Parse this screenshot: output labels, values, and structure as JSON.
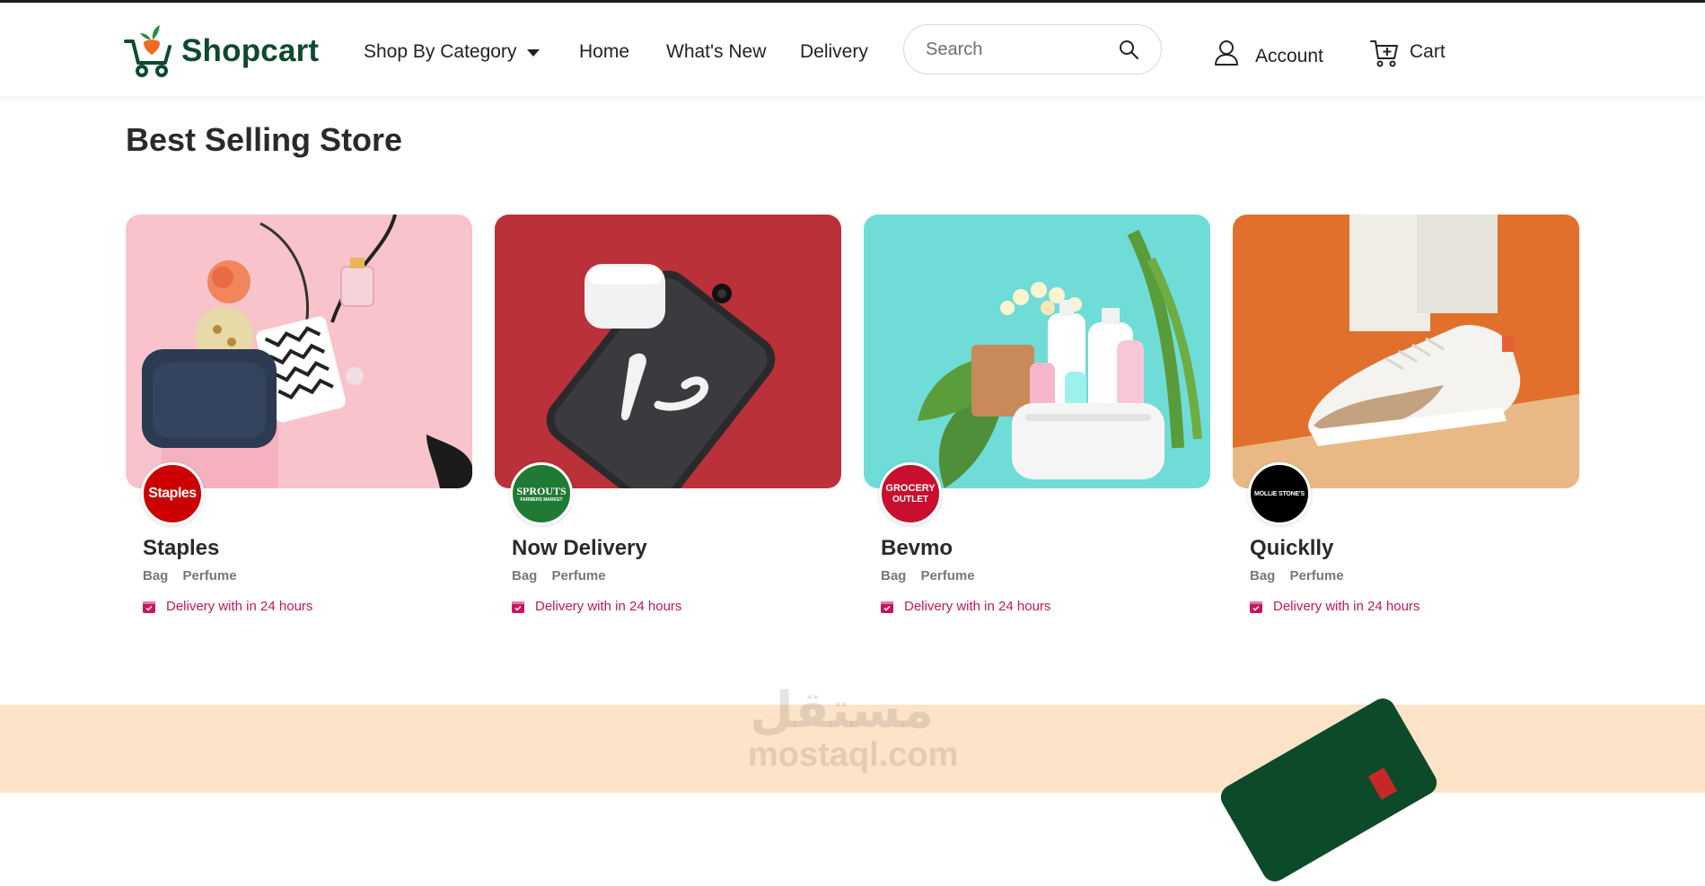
{
  "brand": {
    "name": "Shopcart"
  },
  "nav": {
    "category_label": "Shop By Category",
    "links": [
      "Home",
      "What's New",
      "Delivery"
    ],
    "search_placeholder": "Search",
    "account_label": "Account",
    "cart_label": "Cart"
  },
  "section": {
    "title": "Best Selling Store"
  },
  "stores": [
    {
      "name": "Staples",
      "tags": [
        "Bag",
        "Perfume"
      ],
      "delivery": "Delivery with in 24 hours",
      "logo_text": "Staples",
      "logo_bg": "#cc0000"
    },
    {
      "name": "Now Delivery",
      "tags": [
        "Bag",
        "Perfume"
      ],
      "delivery": "Delivery with in 24 hours",
      "logo_text": "SPROUTS",
      "logo_subtext": "FARMERS MARKET",
      "logo_bg": "#1f7a34"
    },
    {
      "name": "Bevmo",
      "tags": [
        "Bag",
        "Perfume"
      ],
      "delivery": "Delivery with in 24 hours",
      "logo_text": "GROCERY",
      "logo_subtext": "OUTLET",
      "logo_bg": "#c8102e"
    },
    {
      "name": "Quicklly",
      "tags": [
        "Bag",
        "Perfume"
      ],
      "delivery": "Delivery with in 24 hours",
      "logo_text": "MOLLIE STONE'S",
      "logo_bg": "#000000"
    }
  ],
  "watermark": {
    "arabic": "مستقل",
    "latin": "mostaql.com"
  },
  "colors": {
    "brand_green": "#0e4a2c",
    "delivery_pink": "#c2185b",
    "promo_bg": "#fde3c8"
  },
  "icons": [
    "cart-logo-icon",
    "caret-down-icon",
    "search-icon",
    "user-icon",
    "cart-icon",
    "calendar-icon"
  ]
}
